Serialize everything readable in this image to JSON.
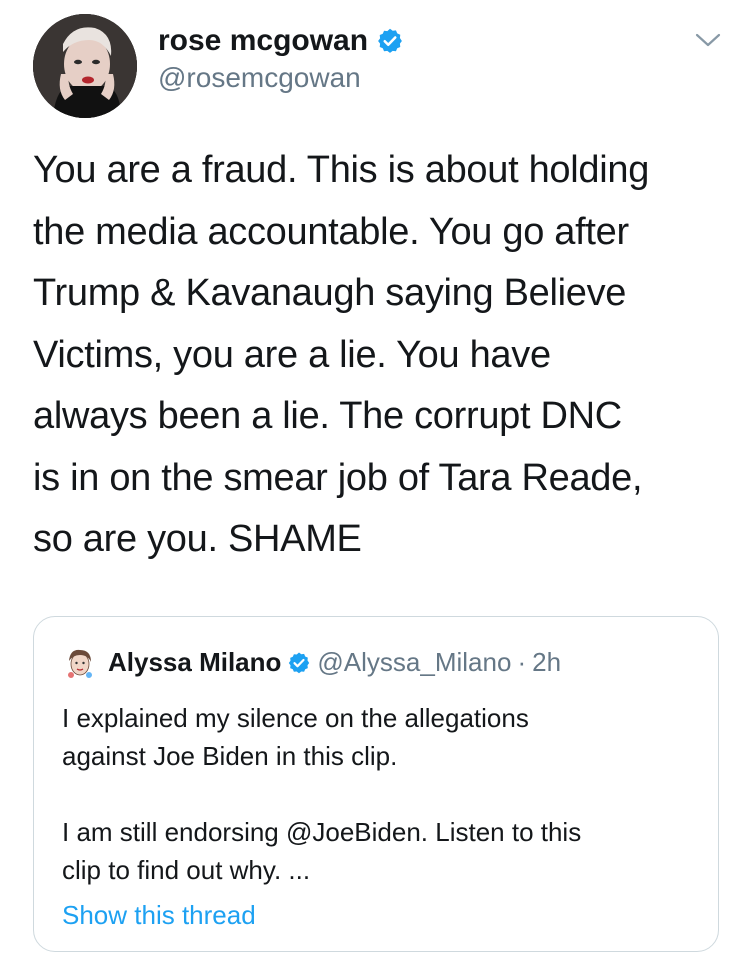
{
  "tweet": {
    "display_name": "rose mcgowan",
    "handle": "@rosemcgowan",
    "text": "You are a fraud. This is about holding\nthe media accountable. You go after\nTrump & Kavanaugh saying Believe\nVictims, you are a lie. You have\nalways been a lie. The corrupt DNC\nis in on the smear job of Tara Reade,\nso are you. SHAME",
    "icons": {
      "verified": "verified-badge-icon",
      "menu": "chevron-down-icon"
    }
  },
  "quoted": {
    "display_name": "Alyssa Milano",
    "handle": "@Alyssa_Milano",
    "separator": "·",
    "time": "2h",
    "text": "I explained my silence on the allegations\nagainst Joe Biden in this clip.\n\nI am still endorsing @JoeBiden. Listen to this\nclip to find out why. ...",
    "show_thread_label": "Show this thread"
  },
  "colors": {
    "verified_blue": "#1da1f2",
    "link_blue": "#1da1f2",
    "secondary_text": "#657786",
    "card_border": "#cfd9de"
  }
}
